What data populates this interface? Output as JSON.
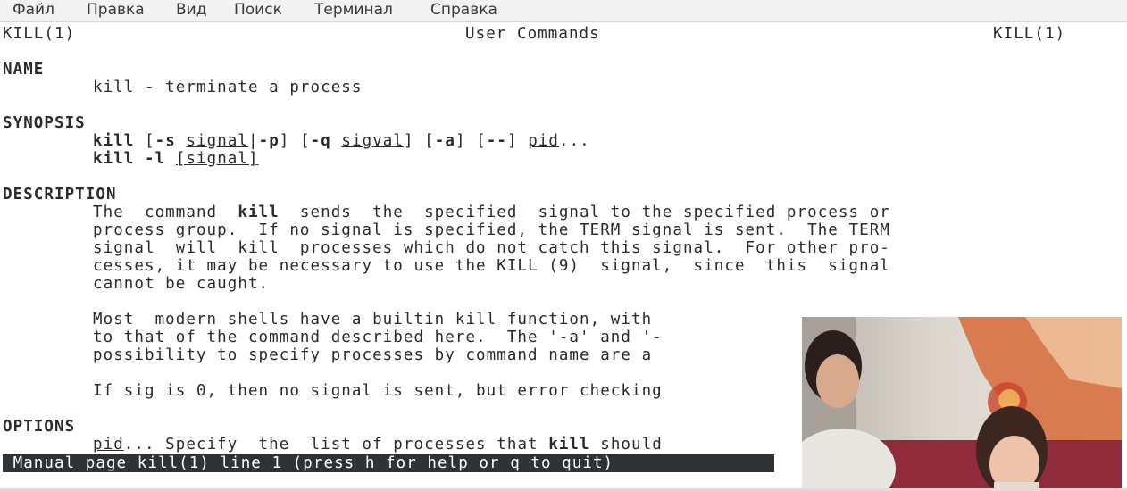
{
  "menu": [
    "Файл",
    "Правка",
    "Вид",
    "Поиск",
    "Терминал",
    "Справка"
  ],
  "man": {
    "header_left": "KILL(1)",
    "header_center": "User Commands",
    "header_right": "KILL(1)",
    "name_heading": "NAME",
    "name_text": "kill - terminate a process",
    "synopsis_heading": "SYNOPSIS",
    "synopsis_line1": {
      "cmd": "kill",
      "p1": " [",
      "opt_s": "-s",
      "p2": " ",
      "arg_signal": "signal",
      "p3": "|",
      "opt_p": "-p",
      "p4": "] [",
      "opt_q": "-q",
      "p5": " ",
      "arg_sigval": "sigval",
      "p6": "] [",
      "opt_a": "-a",
      "p7": "] [",
      "opt_dd": "--",
      "p8": "] ",
      "arg_pid": "pid",
      "p9": "..."
    },
    "synopsis_line2": {
      "cmd": "kill",
      "p1": " ",
      "opt_l": "-l",
      "p2": " ",
      "arg_signal": "[signal]"
    },
    "description_heading": "DESCRIPTION",
    "desc_line1_a": "The  command  ",
    "desc_line1_cmd": "kill",
    "desc_line1_b": "  sends  the  specified  signal to the specified process or",
    "desc_line2": "process group.  If no signal is specified, the TERM signal is sent.  The TERM",
    "desc_line3": "signal  will  kill  processes which do not catch this signal.  For other pro-",
    "desc_line4": "cesses, it may be necessary to use the KILL (9)  signal,  since  this  signal",
    "desc_line5": "cannot be caught.",
    "desc_line6": "Most  modern shells have a builtin kill function, with ",
    "desc_line7": "to that of the command described here.  The '-a' and '-",
    "desc_line8": "possibility to specify processes by command name are a",
    "desc_line9": "If sig is 0, then no signal is sent, but error checking",
    "options_heading": "OPTIONS",
    "opt_line1_arg": "pid",
    "opt_line1_a": "... Specify  the  list of processes that ",
    "opt_line1_cmd": "kill",
    "opt_line1_b": " should"
  },
  "status_bar": " Manual page kill(1) line 1 (press h for help or q to quit)"
}
